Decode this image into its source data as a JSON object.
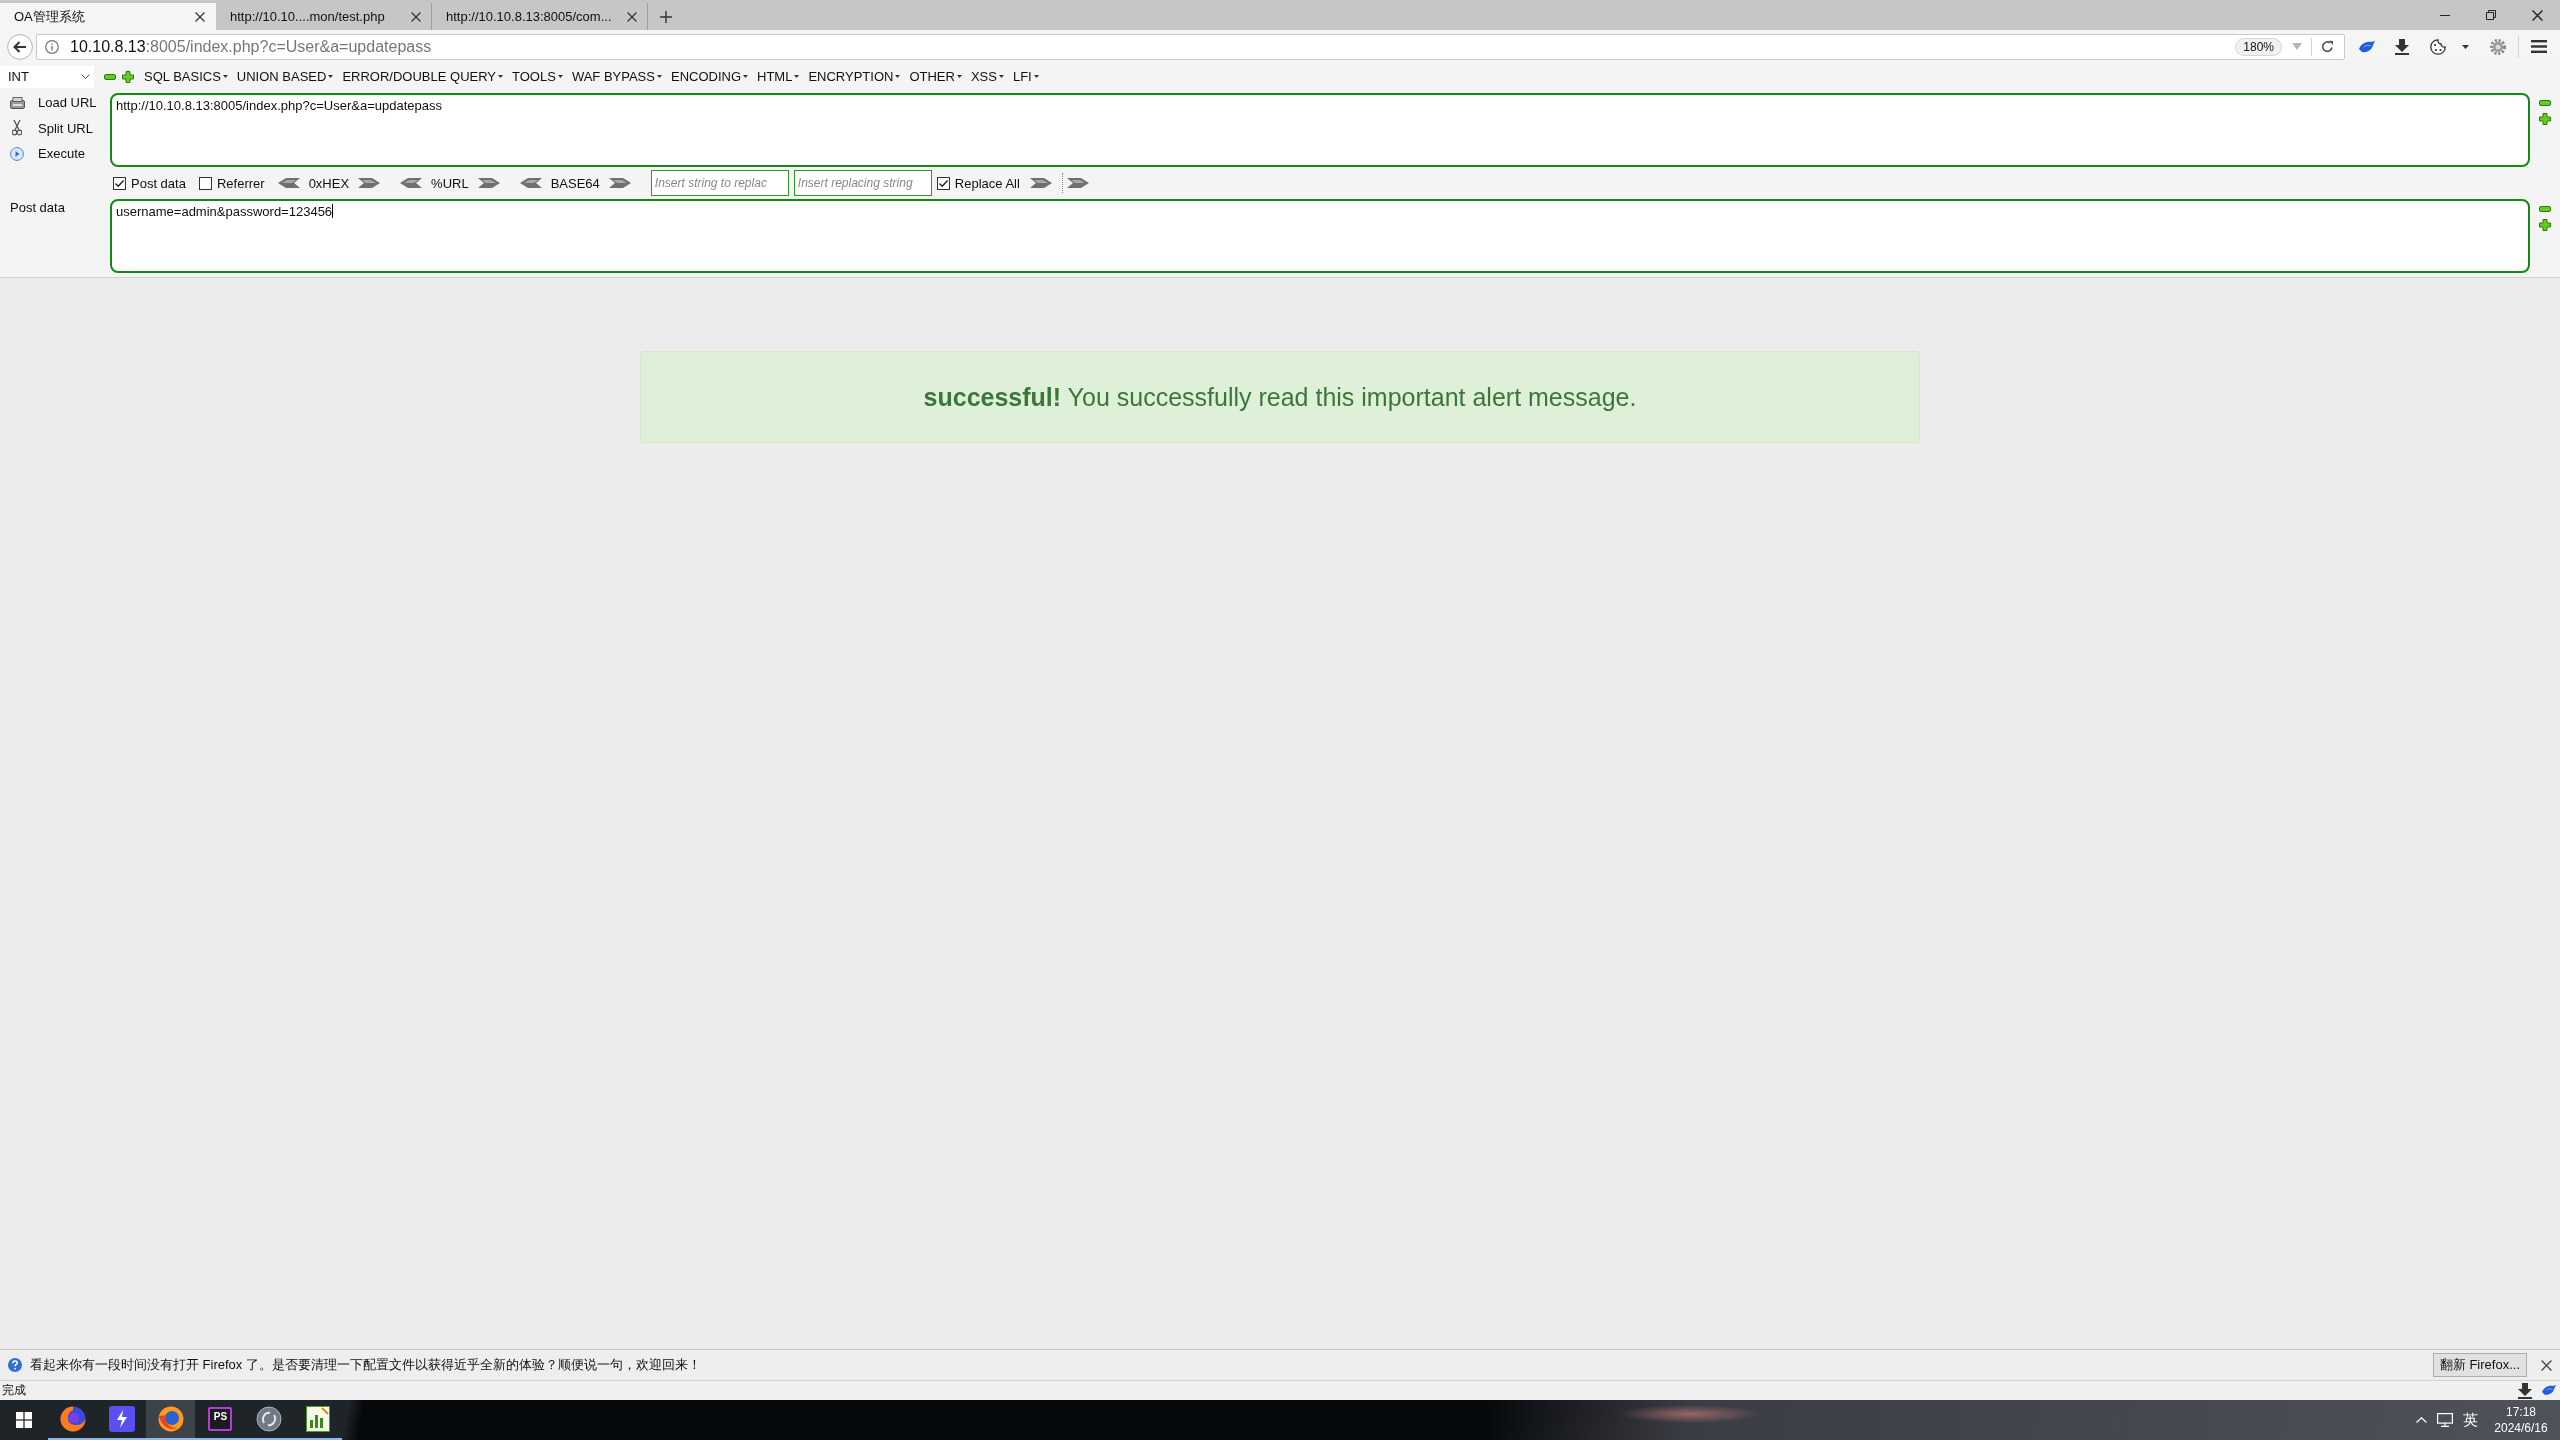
{
  "browser": {
    "tabs": [
      {
        "label": "OA管理系统",
        "selected": true
      },
      {
        "label": "http://10.10....mon/test.php",
        "selected": false
      },
      {
        "label": "http://10.10.8.13:8005/com...",
        "selected": false
      }
    ],
    "address": {
      "host": "10.10.8.13",
      "path": ":8005/index.php?c=User&a=updatepass"
    },
    "zoom": "180%"
  },
  "hackbar": {
    "mode": "INT",
    "menus": [
      "SQL BASICS",
      "UNION BASED",
      "ERROR/DOUBLE QUERY",
      "TOOLS",
      "WAF BYPASS",
      "ENCODING",
      "HTML",
      "ENCRYPTION",
      "OTHER",
      "XSS",
      "LFI"
    ],
    "actions": [
      "Load URL",
      "Split URL",
      "Execute"
    ],
    "url": "http://10.10.8.13:8005/index.php?c=User&a=updatepass",
    "options": [
      {
        "kind": "checkbox",
        "label": "Post data",
        "checked": true
      },
      {
        "kind": "checkbox",
        "label": "Referrer",
        "checked": false
      },
      {
        "kind": "codec",
        "label": "0xHEX"
      },
      {
        "kind": "codec",
        "label": "%URL"
      },
      {
        "kind": "codec",
        "label": "BASE64"
      },
      {
        "kind": "input",
        "placeholder": "Insert string to replac"
      },
      {
        "kind": "input",
        "placeholder": "Insert replacing string"
      },
      {
        "kind": "checkbox",
        "label": "Replace All",
        "checked": true
      }
    ],
    "post": {
      "label": "Post data",
      "value": "username=admin&password=123456"
    }
  },
  "alert": {
    "message": "**successful!** You successfully read this important alert message."
  },
  "notification": {
    "message": "看起来你有一段时间没有打开 Firefox 了。是否要清理一下配置文件以获得近乎全新的体验？顺便说一句，欢迎回来！",
    "button": "翻新 Firefox..."
  },
  "status_bar": {
    "text": "完成"
  },
  "taskbar": {
    "apps": [
      {
        "kind": "globe",
        "selected": false
      },
      {
        "kind": "bolt",
        "selected": false
      },
      {
        "kind": "fox",
        "selected": true
      },
      {
        "kind": "ide",
        "label": "PS",
        "selected": false
      },
      {
        "kind": "disc",
        "selected": false
      },
      {
        "kind": "chart",
        "selected": false
      }
    ],
    "language": "英",
    "time": "17:18",
    "date": "2024/6/16"
  }
}
